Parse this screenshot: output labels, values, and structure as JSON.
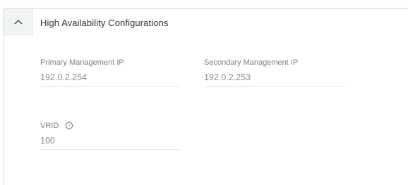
{
  "section": {
    "title": "High Availability Configurations",
    "toggle_icon": "chevron-up-icon"
  },
  "fields": {
    "primary_ip": {
      "label": "Primary Management IP",
      "value": "192.0.2.254"
    },
    "secondary_ip": {
      "label": "Secondary Management IP",
      "value": "192.0.2.253"
    },
    "vrid": {
      "label": "VRID",
      "value": "100",
      "help_icon": "info-icon"
    }
  },
  "colors": {
    "toggle_bg": "#f0f4f3",
    "label": "#7b7f83",
    "value": "#8a8d90",
    "title": "#333333"
  }
}
